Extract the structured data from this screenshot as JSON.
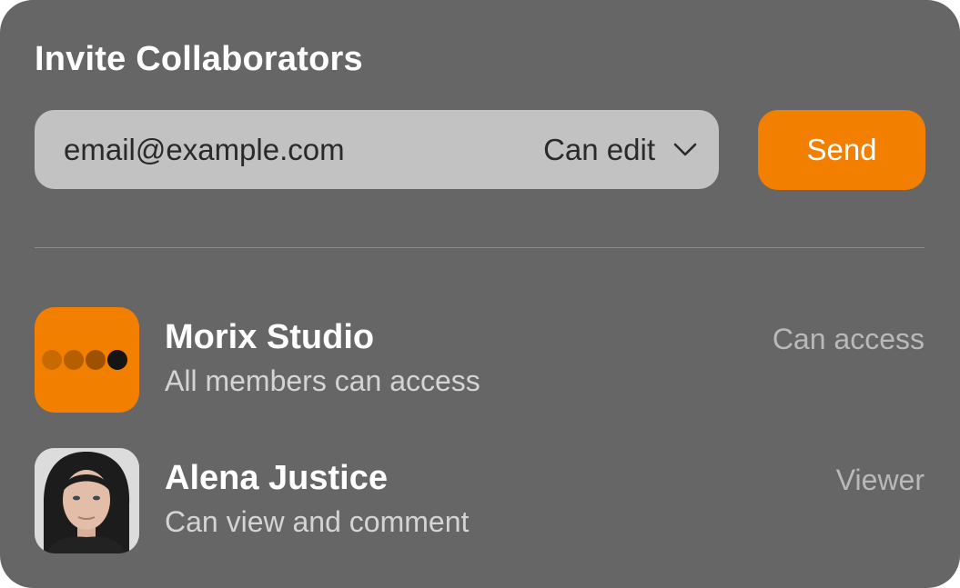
{
  "dialog": {
    "title": "Invite Collaborators"
  },
  "invite": {
    "email_placeholder": "email@example.com",
    "email_value": "",
    "permission": "Can edit",
    "send_label": "Send"
  },
  "members": [
    {
      "name": "Morix Studio",
      "description": "All members can access",
      "role": "Can access",
      "avatar": "org-logo"
    },
    {
      "name": "Alena Justice",
      "description": "Can view and comment",
      "role": "Viewer",
      "avatar": "person-photo"
    }
  ],
  "colors": {
    "card_background": "#666666",
    "accent": "#f27f00",
    "input_background": "#c2c2c2"
  },
  "icons": {
    "permission_dropdown": "chevron-down-icon",
    "org_logo": "four-dots-logo"
  }
}
